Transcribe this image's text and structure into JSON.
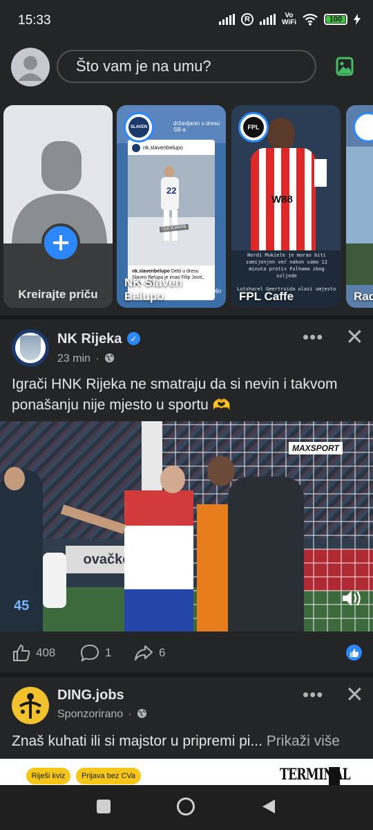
{
  "status_bar": {
    "time": "15:33",
    "volte": [
      "Vo",
      "WiFi"
    ],
    "battery": "100"
  },
  "composer": {
    "placeholder": "Što vam je na umu?"
  },
  "stories": [
    {
      "name": "Kreirajte priču"
    },
    {
      "name": "NK Slaven Belupo",
      "header_text": "državljanin u dresu SB-a",
      "account": "nk.slavenbelupo",
      "jersey_number": "22",
      "caption_account": "nk.slavenbelupo",
      "caption": "Debi u dresu Slaven Belupa je imao Filip Jović, stop... više",
      "overlay_line": "Destikke na debiju @filipe.jovic",
      "click_label": "CLICK HERE"
    },
    {
      "name": "FPL Caffe",
      "shirt_sponsor": "W88",
      "caption": "Nordi Mukiele je morao biti zamijenjen već nakon samo 12 minuta protiv Fulhama zbog ozljede",
      "caption_2": "Lutsharel Geertruida ulazi umjesto"
    },
    {
      "name": "Rad"
    }
  ],
  "post": {
    "page_name": "NK Rijeka",
    "time": "23 min",
    "separator": "·",
    "text": "Igrači HNK Rijeka ne smatraju da si nevin i takvom ponašanju nije mjesto u sportu 🫶",
    "video_watermark": "MAXSPORT",
    "ad_board": "ovačko",
    "player_number": "45",
    "likes": "408",
    "comments": "1",
    "shares": "6"
  },
  "sponsored": {
    "name": "DING.jobs",
    "label": "Sponzorirano",
    "separator": "·",
    "text": "Znaš kuhati ili si majstor u pripremi pi...",
    "more": "Prikaži više",
    "ad_buttons": [
      "Riješi kviz",
      "Prijava bez CVa"
    ],
    "ad_logo": "TERMINAL"
  },
  "colors": {
    "background": "#242526",
    "accent": "#2d88ff",
    "photo_icon": "#45bd62"
  },
  "icons": [
    "signal-icon",
    "roaming-icon",
    "wifi-icon",
    "battery-icon",
    "charging-icon",
    "photo-icon",
    "plus-icon",
    "verified-icon",
    "globe-icon",
    "more-options-icon",
    "close-icon",
    "like-icon",
    "comment-icon",
    "share-icon",
    "volume-icon",
    "recent-apps-icon",
    "home-icon",
    "back-icon"
  ]
}
